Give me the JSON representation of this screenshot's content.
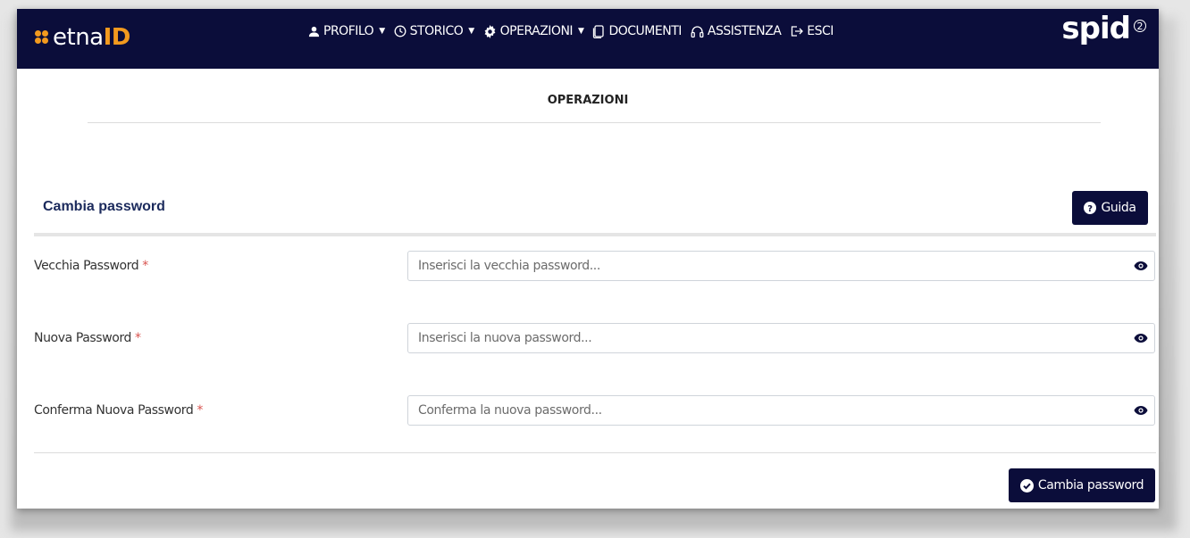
{
  "brand": {
    "prefix": "etna",
    "suffix": "ID",
    "accent": "#f39a1e"
  },
  "nav": {
    "items": [
      {
        "label": "PROFILO",
        "icon": "user-icon",
        "has_caret": true
      },
      {
        "label": "STORICO",
        "icon": "clock-icon",
        "has_caret": true
      },
      {
        "label": "OPERAZIONI",
        "icon": "gear-icon",
        "has_caret": true
      },
      {
        "label": "DOCUMENTI",
        "icon": "documents-icon",
        "has_caret": false
      },
      {
        "label": "ASSISTENZA",
        "icon": "headset-icon",
        "has_caret": false
      },
      {
        "label": "ESCI",
        "icon": "logout-icon",
        "has_caret": false
      }
    ]
  },
  "spid": {
    "logo_text": "spid",
    "reg_mark": "2"
  },
  "page": {
    "title": "OPERAZIONI"
  },
  "section": {
    "title": "Cambia password"
  },
  "help_button": {
    "label": "Guida",
    "icon": "question-circle-icon"
  },
  "form": {
    "required_mark": "*",
    "fields": [
      {
        "label": "Vecchia Password",
        "placeholder": "Inserisci la vecchia password...",
        "value": ""
      },
      {
        "label": "Nuova Password",
        "placeholder": "Inserisci la nuova password...",
        "value": ""
      },
      {
        "label": "Conferma Nuova Password",
        "placeholder": "Conferma la nuova password...",
        "value": ""
      }
    ]
  },
  "submit_button": {
    "label": "Cambia password",
    "icon": "check-circle-icon"
  },
  "colors": {
    "navbar": "#0b0d3a",
    "section_title": "#1b2a5c",
    "required": "#d9534f"
  }
}
